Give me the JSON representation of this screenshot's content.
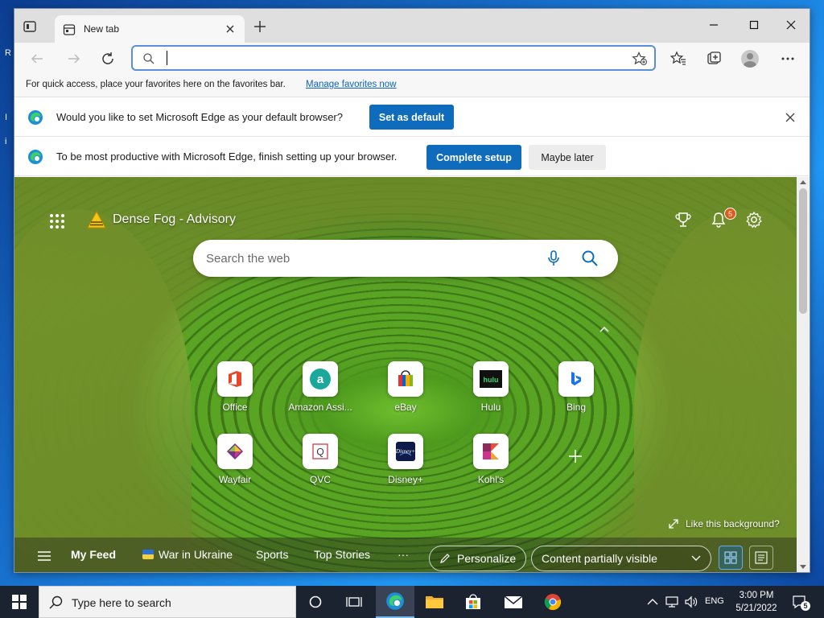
{
  "browser": {
    "tab_title": "New tab",
    "address_value": "",
    "favbar": {
      "text": "For quick access, place your favorites here on the favorites bar.",
      "link": "Manage favorites now"
    },
    "infobar_default": {
      "message": "Would you like to set Microsoft Edge as your default browser?",
      "button": "Set as default"
    },
    "infobar_setup": {
      "message": "To be most productive with Microsoft Edge, finish setting up your browser.",
      "primary_button": "Complete setup",
      "secondary_button": "Maybe later"
    }
  },
  "newtab": {
    "weather": "Dense Fog - Advisory",
    "notification_count": "5",
    "search_placeholder": "Search the web",
    "tiles": [
      {
        "label": "Office"
      },
      {
        "label": "Amazon Assi..."
      },
      {
        "label": "eBay"
      },
      {
        "label": "Hulu"
      },
      {
        "label": "Bing"
      },
      {
        "label": "Wayfair"
      },
      {
        "label": "QVC"
      },
      {
        "label": "Disney+"
      },
      {
        "label": "Kohl's"
      }
    ],
    "like_background": "Like this background?",
    "feed": {
      "items": [
        "My Feed",
        "War in Ukraine",
        "Sports",
        "Top Stories",
        "···"
      ],
      "personalize": "Personalize",
      "content_visibility": "Content partially visible"
    }
  },
  "taskbar": {
    "search_placeholder": "Type here to search",
    "language": "ENG",
    "time": "3:00 PM",
    "date": "5/21/2022",
    "notification_count": "5"
  },
  "colors": {
    "accent": "#0f6cbd",
    "taskbar": "#1b2230",
    "tab_bar": "#dfdfdf"
  }
}
